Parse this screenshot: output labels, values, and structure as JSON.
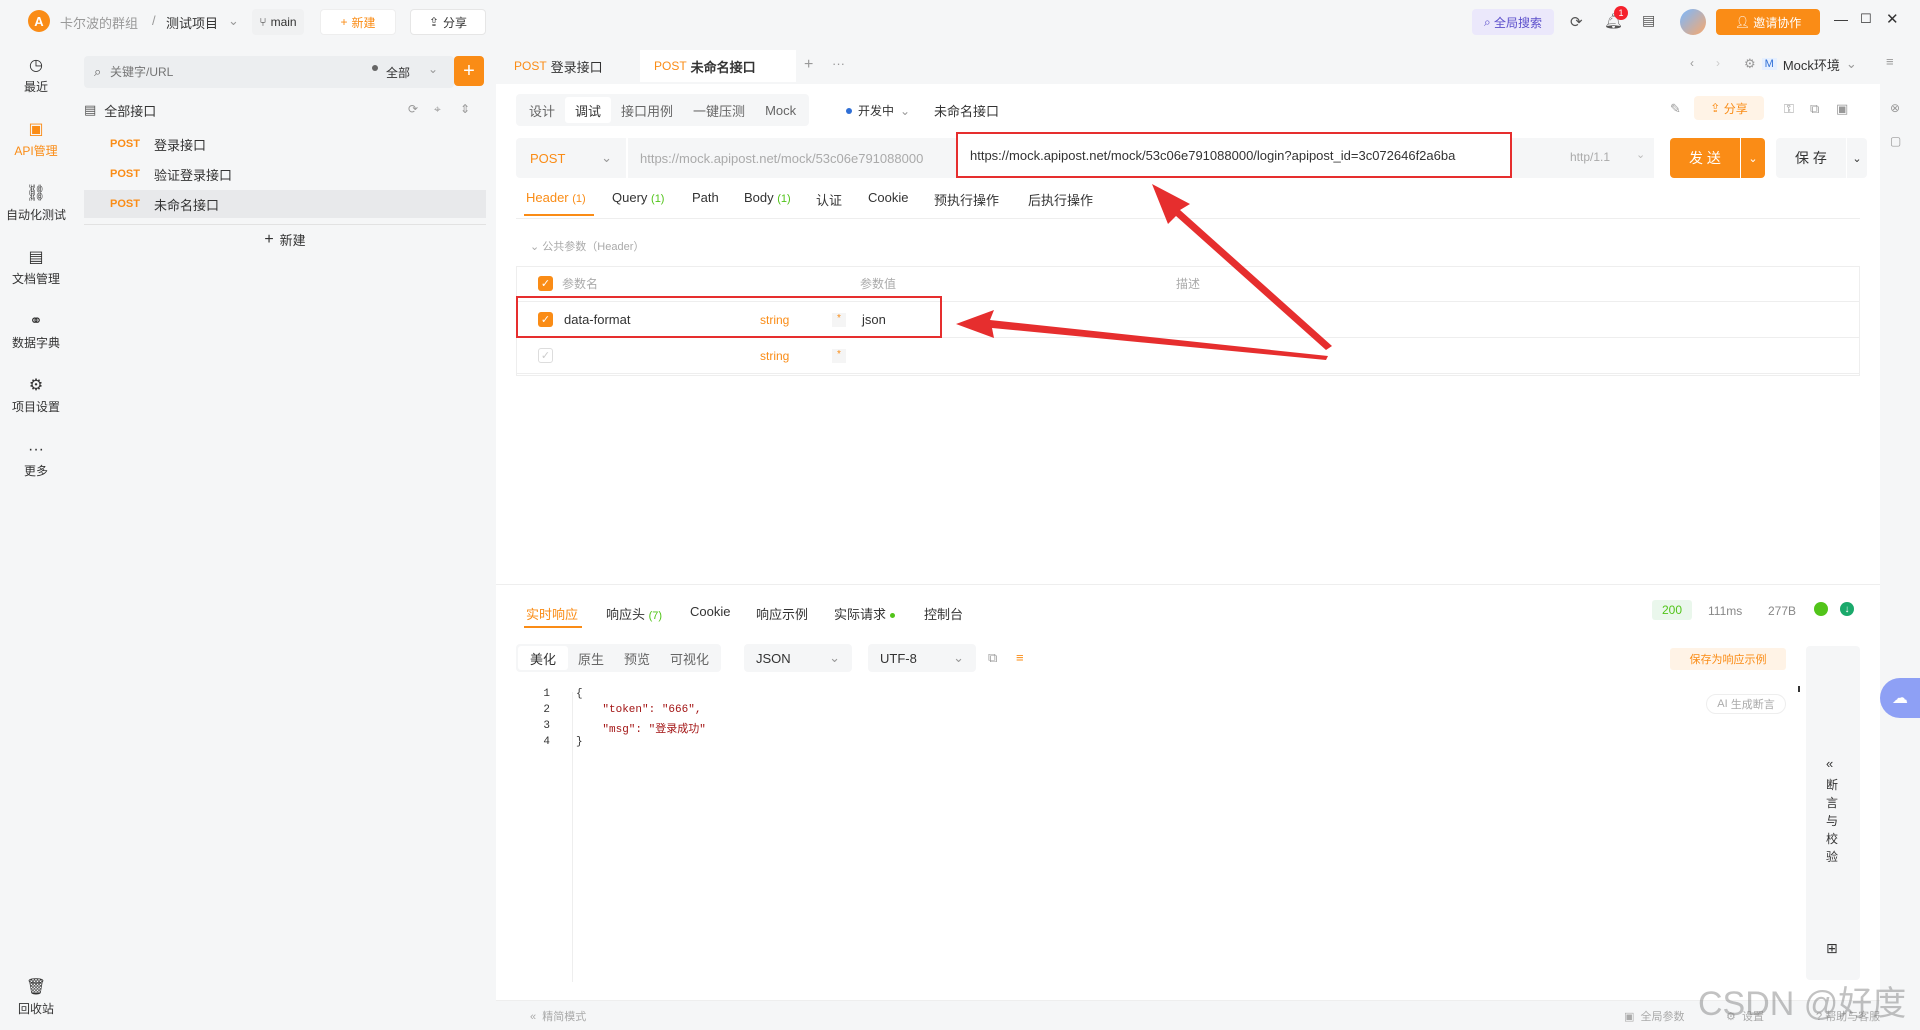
{
  "topbar": {
    "team": "卡尔波的群组",
    "sep": "/",
    "project": "测试项目",
    "branch": "main",
    "new_label": "新建",
    "share_label": "分享",
    "global_search": "全局搜索",
    "notif_count": "1",
    "invite_label": "邀请协作"
  },
  "sidebar": {
    "items": [
      {
        "label": "最近",
        "icon": "clock-icon"
      },
      {
        "label": "API管理",
        "icon": "api-icon"
      },
      {
        "label": "自动化测试",
        "icon": "flow-icon"
      },
      {
        "label": "文档管理",
        "icon": "doc-icon"
      },
      {
        "label": "数据字典",
        "icon": "dict-icon"
      },
      {
        "label": "项目设置",
        "icon": "settings-icon"
      },
      {
        "label": "更多",
        "icon": "more-icon"
      }
    ],
    "trash": "回收站"
  },
  "tree": {
    "search_placeholder": "关键字/URL",
    "filter": "全部",
    "root": "全部接口",
    "items": [
      {
        "method": "POST",
        "name": "登录接口"
      },
      {
        "method": "POST",
        "name": "验证登录接口"
      },
      {
        "method": "POST",
        "name": "未命名接口"
      }
    ],
    "new_label": "新建"
  },
  "tabs": {
    "items": [
      {
        "method": "POST",
        "name": "登录接口"
      },
      {
        "method": "POST",
        "name": "未命名接口"
      }
    ],
    "env": "Mock环境",
    "env_badge": "M"
  },
  "editor": {
    "subtabs": [
      "设计",
      "调试",
      "接口用例",
      "一键压测",
      "Mock"
    ],
    "status": "开发中",
    "api_name": "未命名接口",
    "share": "分享",
    "method": "POST",
    "url_prefix": "https://mock.apipost.net/mock/53c06e791088000",
    "url_full": "https://mock.apipost.net/mock/53c06e791088000/login?apipost_id=3c072646f2a6ba",
    "protocol": "http/1.1",
    "send": "发 送",
    "save": "保 存",
    "param_tabs": [
      {
        "label": "Header",
        "count": "(1)"
      },
      {
        "label": "Query",
        "count": "(1)"
      },
      {
        "label": "Path",
        "count": ""
      },
      {
        "label": "Body",
        "count": "(1)"
      },
      {
        "label": "认证",
        "count": ""
      },
      {
        "label": "Cookie",
        "count": ""
      },
      {
        "label": "预执行操作",
        "count": ""
      },
      {
        "label": "后执行操作",
        "count": ""
      }
    ],
    "public_params": "公共参数（Header）",
    "col_name": "参数名",
    "col_value": "参数值",
    "col_desc": "描述",
    "rows": [
      {
        "name": "data-format",
        "type": "string",
        "value": "json"
      },
      {
        "name": "",
        "type": "string",
        "value": ""
      }
    ]
  },
  "response": {
    "tabs": [
      "实时响应",
      "响应头",
      "Cookie",
      "响应示例",
      "实际请求",
      "控制台"
    ],
    "header_count": "(7)",
    "status": "200",
    "time": "111ms",
    "size": "277B",
    "views": [
      "美化",
      "原生",
      "预览",
      "可视化"
    ],
    "format": "JSON",
    "encoding": "UTF-8",
    "save_example": "保存为响应示例",
    "gen_assert": "生成断言",
    "assert_panel": "断言与校验",
    "code_lines": [
      {
        "n": "1",
        "text": "{"
      },
      {
        "n": "2",
        "text": "    \"token\": \"666\","
      },
      {
        "n": "3",
        "text": "    \"msg\": \"登录成功\""
      },
      {
        "n": "4",
        "text": "}"
      }
    ]
  },
  "statusbar": {
    "simple_mode": "精简模式",
    "global_params": "全局参数",
    "settings": "设置",
    "help": "帮助与客服"
  },
  "watermark": "CSDN @好度",
  "colors": {
    "accent": "#fa8c16",
    "annotation": "#e62e2e",
    "status_ok": "#52c41a"
  }
}
